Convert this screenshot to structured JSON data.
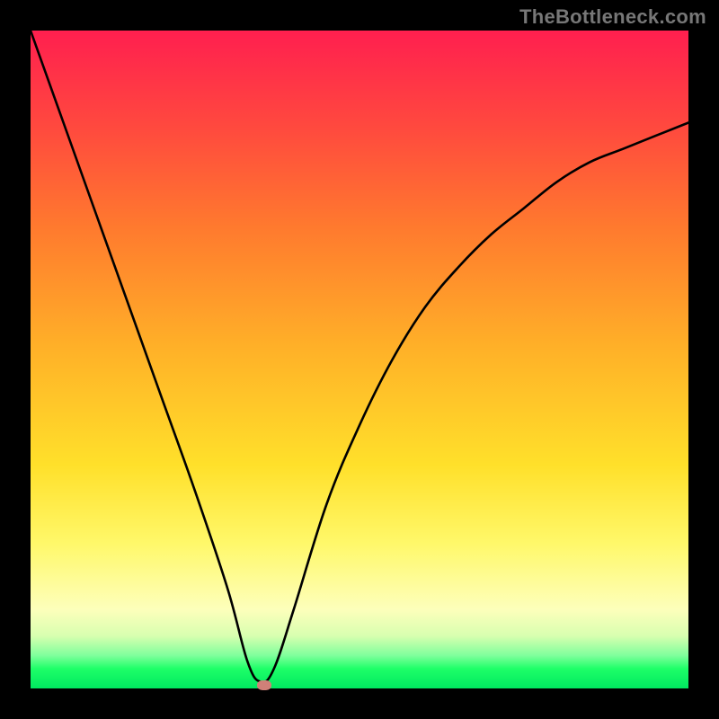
{
  "watermark": "TheBottleneck.com",
  "chart_data": {
    "type": "line",
    "title": "",
    "xlabel": "",
    "ylabel": "",
    "xlim": [
      0,
      100
    ],
    "ylim": [
      0,
      100
    ],
    "grid": false,
    "legend": false,
    "note": "V-shaped curve over a vertical red→green gradient; minimum near x≈35. Values eyeballed from the figure (no labeled ticks).",
    "series": [
      {
        "name": "curve",
        "x": [
          0,
          5,
          10,
          15,
          20,
          25,
          30,
          33,
          35,
          37,
          40,
          45,
          50,
          55,
          60,
          65,
          70,
          75,
          80,
          85,
          90,
          95,
          100
        ],
        "values": [
          100,
          86,
          72,
          58,
          44,
          30,
          15,
          4,
          1,
          3,
          12,
          28,
          40,
          50,
          58,
          64,
          69,
          73,
          77,
          80,
          82,
          84,
          86
        ]
      }
    ],
    "marker": {
      "x": 35.5,
      "y": 0.6,
      "color": "#d08078"
    },
    "gradient_stops": [
      {
        "pos": 0,
        "color": "#ff1f4f"
      },
      {
        "pos": 15,
        "color": "#ff4a3e"
      },
      {
        "pos": 30,
        "color": "#ff7a2e"
      },
      {
        "pos": 48,
        "color": "#ffb028"
      },
      {
        "pos": 66,
        "color": "#ffe02a"
      },
      {
        "pos": 78,
        "color": "#fff86a"
      },
      {
        "pos": 88,
        "color": "#fdffbb"
      },
      {
        "pos": 92,
        "color": "#d8ffb0"
      },
      {
        "pos": 95,
        "color": "#7fff9c"
      },
      {
        "pos": 97,
        "color": "#1eff68"
      },
      {
        "pos": 100,
        "color": "#00e860"
      }
    ]
  }
}
